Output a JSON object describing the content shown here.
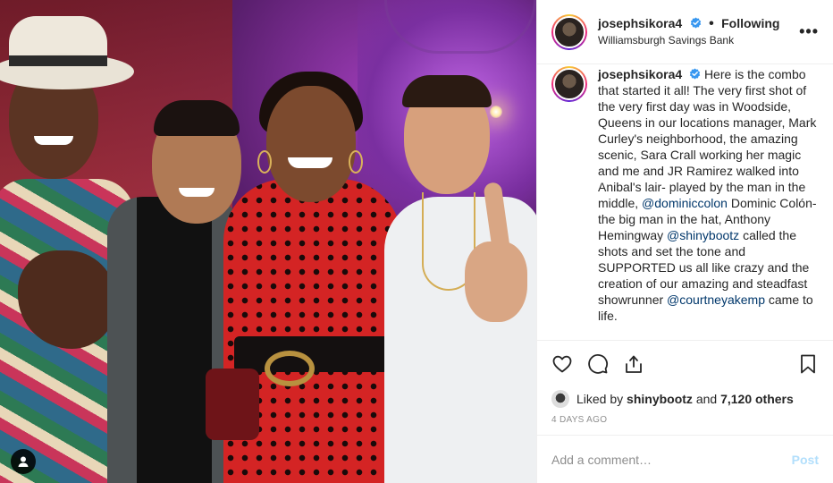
{
  "post": {
    "author": {
      "username": "josephsikora4",
      "verified": true,
      "follow_status": "Following",
      "location": "Williamsburgh Savings Bank"
    },
    "caption": {
      "username": "josephsikora4",
      "text_1": "Here is the combo that started it all! The very first shot of the very first day was in Woodside, Queens in our locations manager, Mark Curley's neighborhood, the amazing scenic, Sara Crall working her magic and me and JR Ramirez walked into Anibal's lair- played by the man in the middle, ",
      "mention_1": "@dominiccolon",
      "text_2": " Dominic Colón- the big man in the hat, Anthony Hemingway ",
      "mention_2": "@shinybootz",
      "text_3": " called the shots and set the tone and SUPPORTED us all like crazy and the creation of our amazing and steadfast showrunner ",
      "mention_3": "@courtneyakemp",
      "text_4": " came to life."
    },
    "likes": {
      "prefix": "Liked by ",
      "liker": "shinybootz",
      "connector": " and ",
      "others": "7,120 others"
    },
    "date": "4 DAYS AGO",
    "comment": {
      "placeholder": "Add a comment…",
      "post_label": "Post"
    },
    "icons": {
      "more": "more-options-icon",
      "like": "heart-icon",
      "comment": "comment-icon",
      "share": "share-icon",
      "save": "bookmark-icon",
      "tag": "user-tag-icon",
      "verified": "verified-badge-icon"
    },
    "colors": {
      "accent_link": "#00376b",
      "verified_blue": "#3897f0",
      "muted": "#8e8e8e",
      "post_button_disabled": "#b2dffc"
    }
  }
}
